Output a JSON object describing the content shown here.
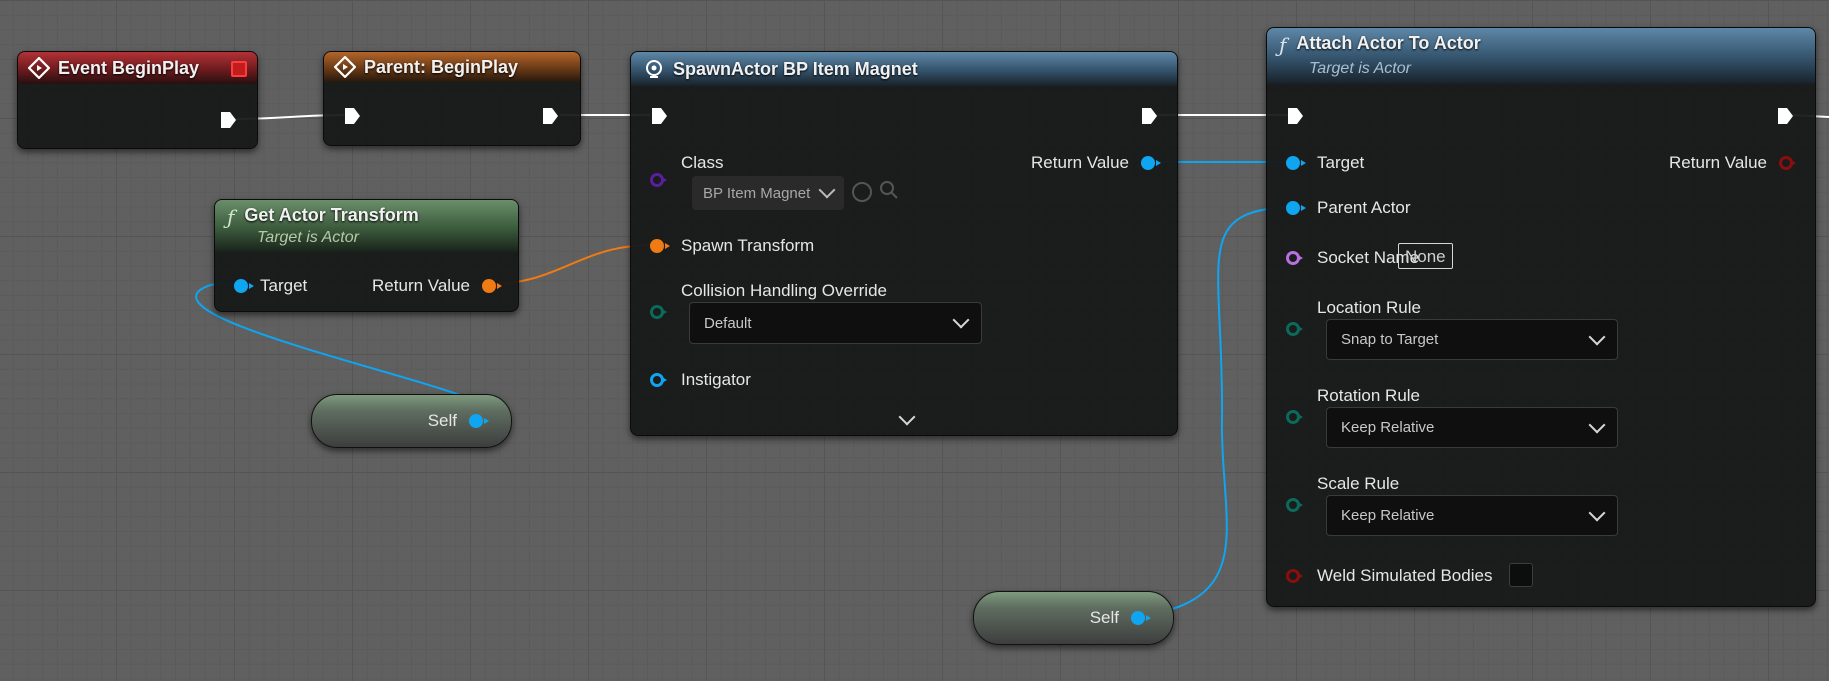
{
  "nodes": {
    "event_begin_play": {
      "title": "Event BeginPlay"
    },
    "parent_begin_play": {
      "title": "Parent: BeginPlay"
    },
    "get_actor_transform": {
      "title": "Get Actor Transform",
      "subtitle": "Target is Actor",
      "target_label": "Target",
      "return_label": "Return Value"
    },
    "spawn_actor": {
      "title": "SpawnActor BP Item Magnet",
      "class_label": "Class",
      "class_value": "BP Item Magnet",
      "return_label": "Return Value",
      "spawn_transform_label": "Spawn Transform",
      "collision_label": "Collision Handling Override",
      "collision_value": "Default",
      "instigator_label": "Instigator"
    },
    "attach_actor": {
      "title": "Attach Actor To Actor",
      "subtitle": "Target is Actor",
      "target_label": "Target",
      "return_label": "Return Value",
      "parent_actor_label": "Parent Actor",
      "socket_name_label": "Socket Name",
      "socket_name_value": "None",
      "location_rule_label": "Location Rule",
      "location_rule_value": "Snap to Target",
      "rotation_rule_label": "Rotation Rule",
      "rotation_rule_value": "Keep Relative",
      "scale_rule_label": "Scale Rule",
      "scale_rule_value": "Keep Relative",
      "weld_label": "Weld Simulated Bodies",
      "weld_checked": false
    },
    "self_1": {
      "label": "Self"
    },
    "self_2": {
      "label": "Self"
    }
  },
  "colors": {
    "object_pin": "#0fa5f0",
    "struct_pin": "#f07a14",
    "class_pin": "#5a1ea0",
    "name_pin": "#b870e0",
    "enum_pin": "#0a6b5c",
    "bool_pin": "#8b0e0e",
    "exec_wire": "#ffffff",
    "event_header": "#b33236",
    "parent_header": "#b3652a",
    "function_header": "#5e87a7",
    "pure_header": "#6a8f6a"
  }
}
